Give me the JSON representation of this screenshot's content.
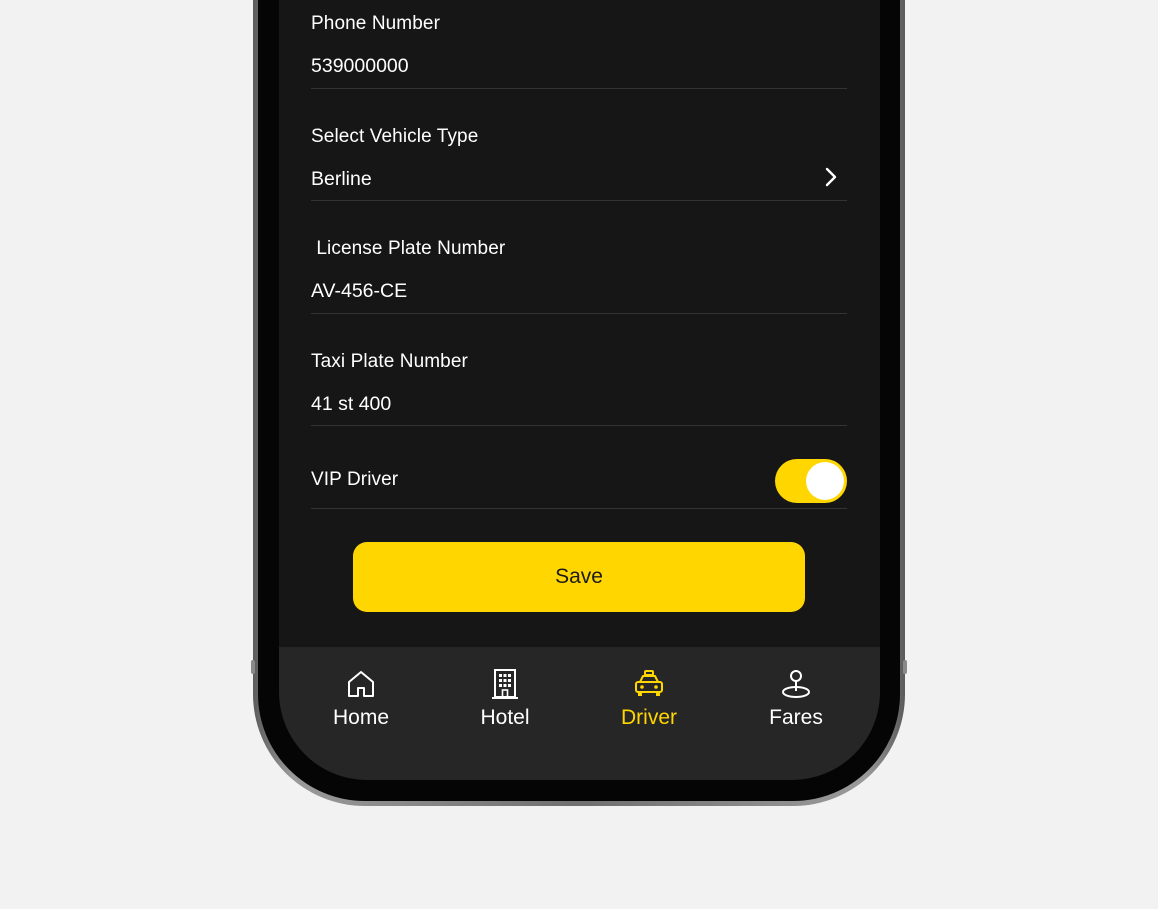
{
  "form": {
    "phone": {
      "label": "Phone Number",
      "value": "539000000"
    },
    "vehicle_type": {
      "label": "Select Vehicle Type",
      "value": "Berline"
    },
    "license_plate": {
      "label": " License Plate Number",
      "value": "AV-456-CE"
    },
    "taxi_plate": {
      "label": "Taxi Plate Number",
      "value": "41 st 400"
    },
    "vip_driver": {
      "label": "VIP Driver",
      "enabled": true
    },
    "save_label": "Save"
  },
  "nav": {
    "active": "Driver",
    "items": [
      {
        "label": "Home",
        "icon": "home-icon"
      },
      {
        "label": "Hotel",
        "icon": "building-icon"
      },
      {
        "label": "Driver",
        "icon": "taxi-icon"
      },
      {
        "label": "Fares",
        "icon": "location-pin-icon"
      }
    ]
  },
  "colors": {
    "accent": "#ffd600",
    "screen_bg": "#161616",
    "nav_bg": "#262626",
    "text": "#ffffff"
  }
}
